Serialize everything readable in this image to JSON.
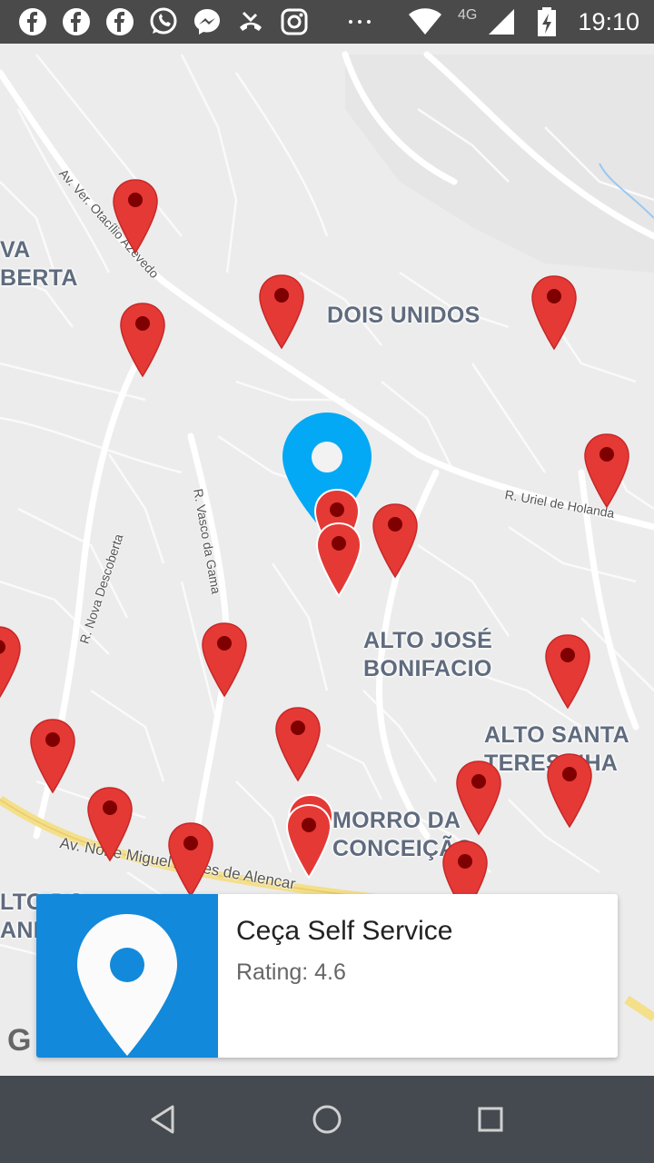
{
  "status_bar": {
    "time": "19:10",
    "network": "4G",
    "notification_icons": [
      "facebook-icon",
      "facebook-icon",
      "facebook-icon",
      "whatsapp-icon",
      "messenger-icon",
      "missed-call-icon",
      "instagram-icon",
      "more-dots-icon"
    ],
    "system_icons": [
      "wifi-icon",
      "signal-icon",
      "battery-charging-icon"
    ]
  },
  "map": {
    "area_labels": [
      "DOIS UNIDOS",
      "ALTO JOSÉ\nBONIFACIO",
      "ALTO SANTA\nTERESINHA",
      "MORRO DA\nCONCEIÇÃO",
      "VA\nBERTA",
      "LTO DO\nANI"
    ],
    "street_labels": [
      "Av. Ver. Otacílio Azevedo",
      "R. Nova Descoberta",
      "R. Vasco da Gama",
      "R. Uriel de Holanda",
      "Av. Norte Miguel Arraes de Alencar"
    ],
    "marker_color": "#e53935",
    "selected_marker_color": "#03a9f4"
  },
  "card": {
    "title": "Ceça Self Service",
    "rating": "Rating: 4.6",
    "thumb_color": "#1289db",
    "thumb_icon": "location-pin-icon"
  },
  "nav_bar": {
    "buttons": [
      "back-icon",
      "home-icon",
      "recents-icon"
    ]
  }
}
